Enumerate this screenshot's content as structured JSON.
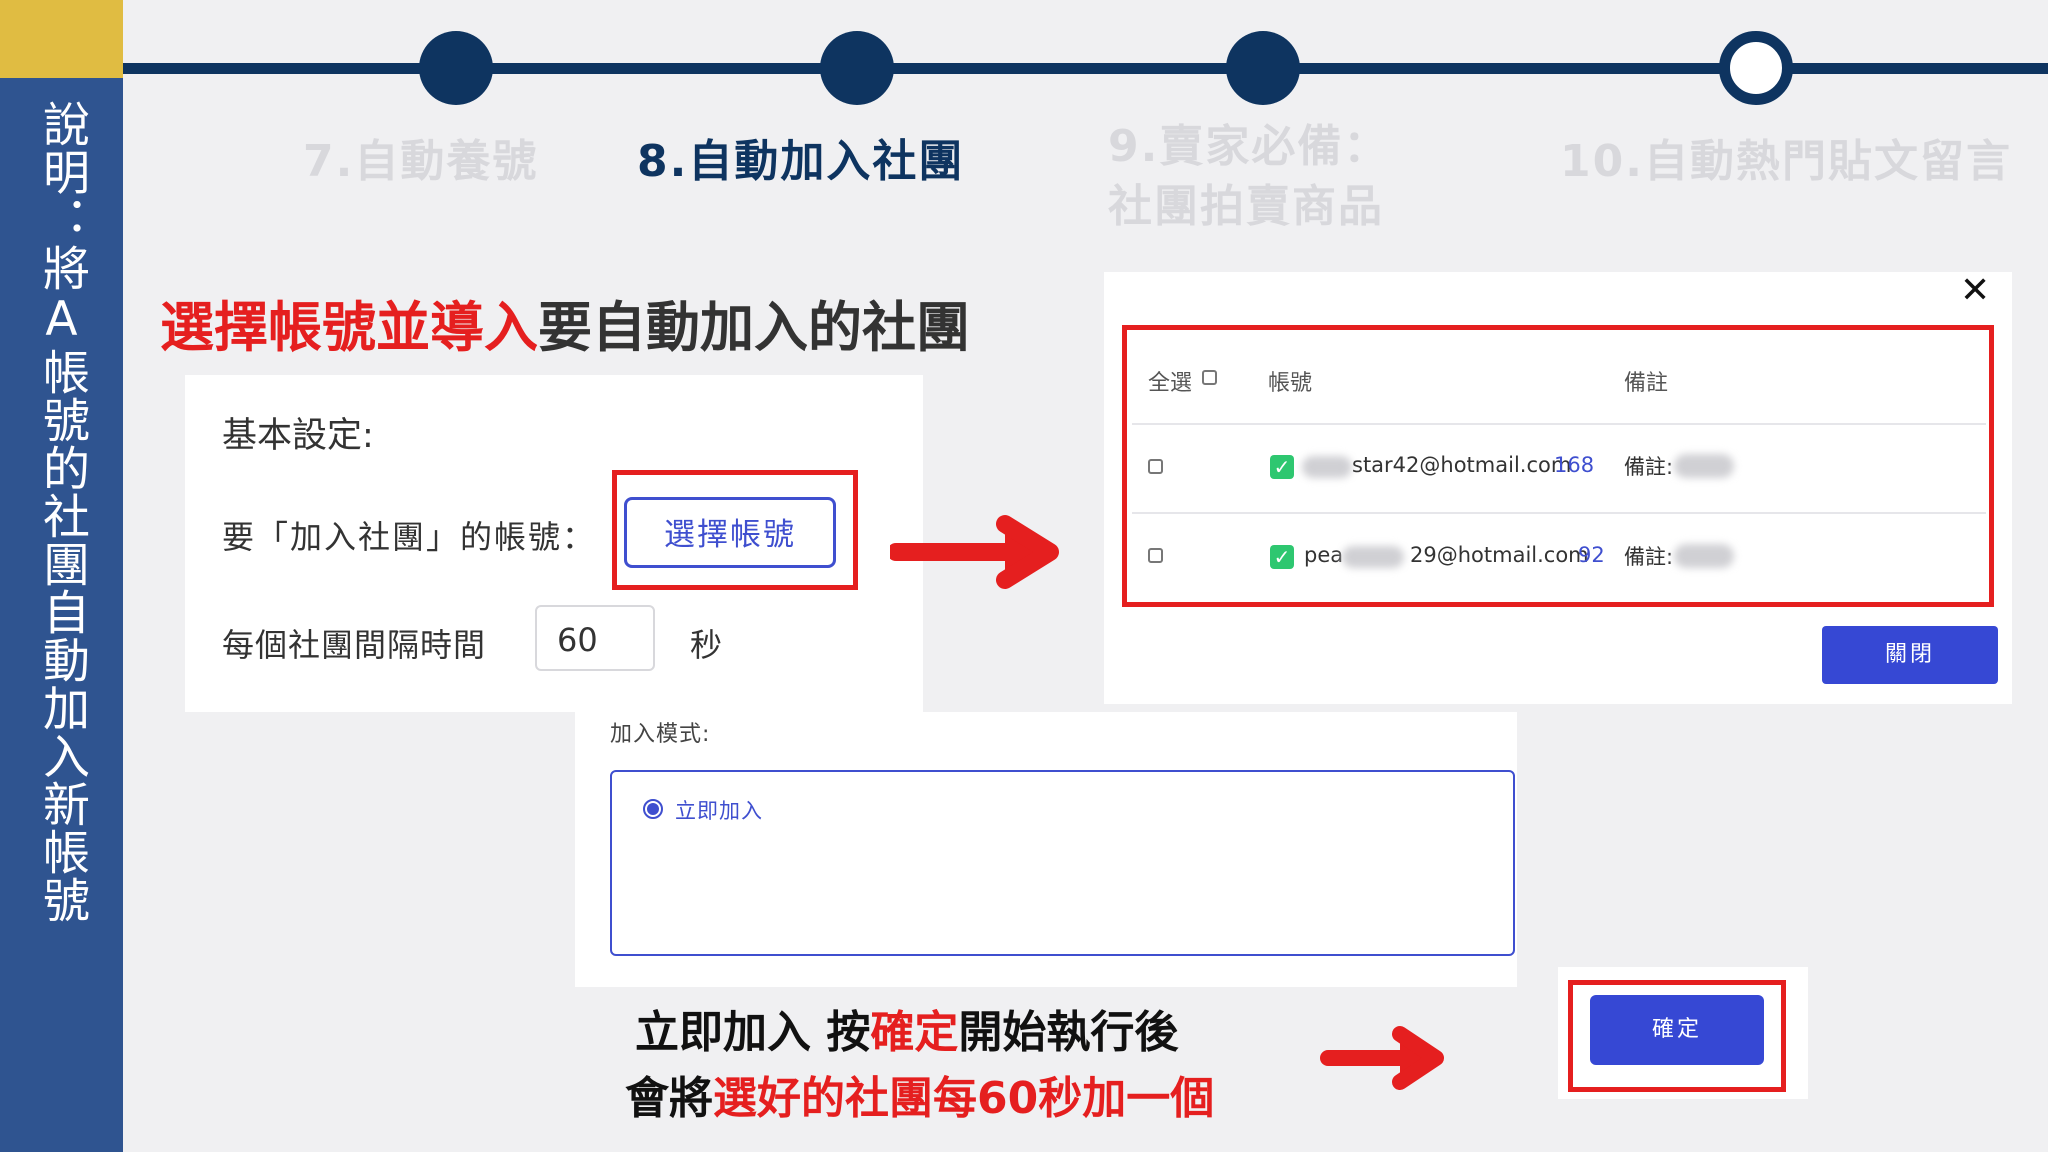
{
  "sidebar": {
    "text": "說明：將A帳號的社團自動加入新帳號"
  },
  "progress": {
    "steps": [
      {
        "label": "7.自動養號"
      },
      {
        "label": "8.自動加入社團"
      },
      {
        "label_line1": "9.賣家必備：",
        "label_line2": "社團拍賣商品"
      },
      {
        "label": "10.自動熱門貼文留言"
      }
    ],
    "active_step": "8.自動加入社團"
  },
  "headline": {
    "red": "選擇帳號並導入",
    "black": "要自動加入的社團"
  },
  "settings": {
    "title": "基本設定:",
    "account_label": "要「加入社團」的帳號：",
    "select_button": "選擇帳號",
    "interval_label": "每個社團間隔時間",
    "interval_value": "60",
    "seconds": "秒"
  },
  "dialog": {
    "close_symbol": "✕",
    "header": {
      "select_all": "全選",
      "account": "帳號",
      "note": "備註"
    },
    "rows": [
      {
        "email": "star42@hotmail.com",
        "count": "168",
        "note_label": "備註:"
      },
      {
        "email_prefix": "pea",
        "email_suffix": "29@hotmail.com",
        "count": "92",
        "note_label": "備註:"
      }
    ],
    "close_button": "關閉"
  },
  "join_mode": {
    "label": "加入模式:",
    "option": "立即加入"
  },
  "bottom": {
    "line1_part1": "立即加入 按",
    "line1_red": "確定",
    "line1_part2": "開始執行後",
    "line2_part1": "會將",
    "line2_red": "選好的社團每60秒加一個"
  },
  "confirm_button": "確定",
  "colors": {
    "navy": "#0e3460",
    "sidebar_blue": "#2f5490",
    "gold": "#e0bc42",
    "accent_red": "#e51f1f",
    "button_blue": "#3648d4"
  }
}
